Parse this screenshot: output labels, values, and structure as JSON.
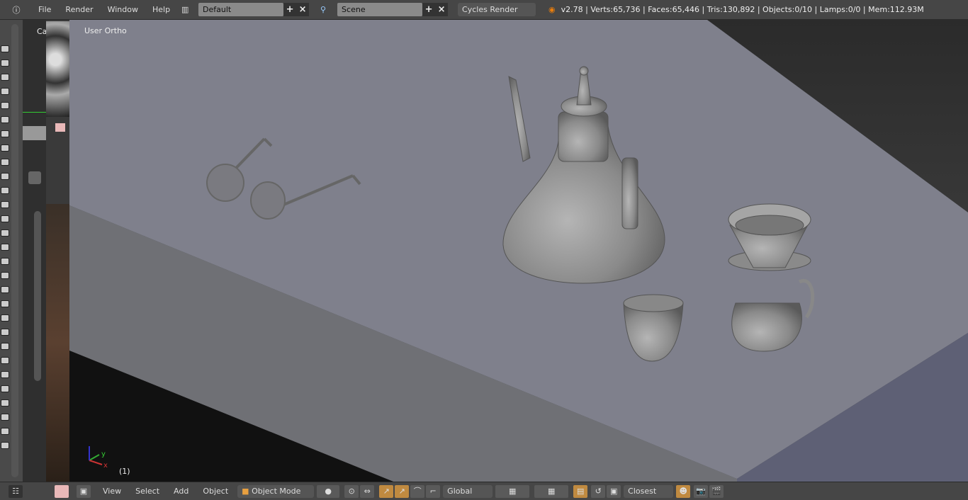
{
  "topbar": {
    "menus": [
      "File",
      "Render",
      "Window",
      "Help"
    ],
    "screen_layout": "Default",
    "scene": "Scene",
    "render_engine": "Cycles Render",
    "stats": "v2.78 | Verts:65,736 | Faces:65,446 | Tris:130,892 | Objects:0/10 | Lamps:0/0 | Mem:112.93M"
  },
  "viewport": {
    "view_label": "User Ortho",
    "frame": "(1)",
    "axis_labels": [
      "y",
      "x",
      "z"
    ]
  },
  "left_panel": {
    "partial_label": "Ca"
  },
  "bottombar": {
    "menus": [
      "View",
      "Select",
      "Add",
      "Object"
    ],
    "mode": "Object Mode",
    "orientation": "Global",
    "snap_target": "Closest"
  },
  "colors": {
    "header": "#464646",
    "table_top": "#7f808c",
    "table_front": "#6f7075",
    "table_side": "#5e6075",
    "active_button": "#c08a40"
  }
}
